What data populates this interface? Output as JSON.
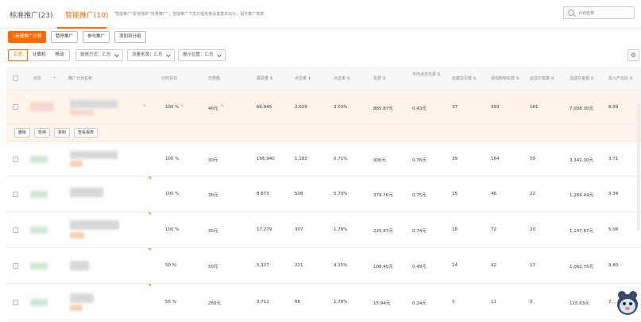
{
  "tabs": {
    "standard": "标准推广(23)",
    "smart": "智能推广(10)",
    "hint": "\"智能推广\"即老版的\"批量推广\"，智能推广下您只需批量设置基本出价，提升推广效率"
  },
  "search": {
    "placeholder": "计划名称"
  },
  "toolbar": {
    "new_plan": "+新建推广计划",
    "pause": "暂停推广",
    "join": "参与推广",
    "add_group": "添加到分组"
  },
  "filters": {
    "seg": [
      "汇总",
      "计算机",
      "移动"
    ],
    "dropdowns": [
      "投放方式：汇总",
      "流量来源：汇总",
      "展示位置：汇总"
    ]
  },
  "headers": {
    "status": "状态",
    "name": "推广计划名称",
    "discount": "分时折扣",
    "budget": "日限额",
    "impressions": "展现量 ⇅",
    "clicks": "点击量 ⬇",
    "ctr": "点击率 ⇅",
    "cost": "花费 ⇅",
    "avg_cpc": "平均点击花费 ⇅",
    "fav": "收藏宝贝数 ⇅",
    "cart": "添加购物车数 ⇅",
    "orders": "总成交笔数 ⇅",
    "gmv": "总成交金额 ⇅",
    "roi": "投入产出比 ⇅"
  },
  "row_actions": [
    "删除",
    "暂停",
    "复制",
    "查看报表"
  ],
  "rows": [
    {
      "discount": "100 %",
      "budget": "40元",
      "impressions": "66,945",
      "clicks": "2,029",
      "ctr": "3.03%",
      "cost": "865.87元",
      "cpc": "0.43元",
      "fav": "37",
      "cart": "393",
      "orders": "181",
      "gmv": "7,008.30元",
      "roi": "8.09"
    },
    {
      "discount": "100 %",
      "budget": "30元",
      "impressions": "166,940",
      "clicks": "1,183",
      "ctr": "0.71%",
      "cost": "900元",
      "cpc": "0.76元",
      "fav": "39",
      "cart": "164",
      "orders": "59",
      "gmv": "3,342.30元",
      "roi": "3.71"
    },
    {
      "discount": "100 %",
      "budget": "30元",
      "impressions": "8,873",
      "clicks": "508",
      "ctr": "5.73%",
      "cost": "379.76元",
      "cpc": "0.75元",
      "fav": "15",
      "cart": "46",
      "orders": "22",
      "gmv": "1,269.44元",
      "roi": "3.34"
    },
    {
      "discount": "100 %",
      "budget": "30元",
      "impressions": "17,279",
      "clicks": "307",
      "ctr": "1.78%",
      "cost": "225.87元",
      "cpc": "0.74元",
      "fav": "18",
      "cart": "72",
      "orders": "20",
      "gmv": "1,147.87元",
      "roi": "5.08"
    },
    {
      "discount": "50 %",
      "budget": "50元",
      "impressions": "5,327",
      "clicks": "221",
      "ctr": "4.15%",
      "cost": "108.45元",
      "cpc": "0.49元",
      "fav": "14",
      "cart": "42",
      "orders": "17",
      "gmv": "1,062.75元",
      "roi": "9.80"
    },
    {
      "discount": "55 %",
      "budget": "250元",
      "impressions": "3,711",
      "clicks": "66",
      "ctr": "1.78%",
      "cost": "15.94元",
      "cpc": "0.24元",
      "fav": "3",
      "cart": "11",
      "orders": "2",
      "gmv": "115.63元",
      "roi": "7.…"
    }
  ],
  "colors": {
    "accent": "#ff6a00",
    "selected_row": "#fff4ea"
  }
}
